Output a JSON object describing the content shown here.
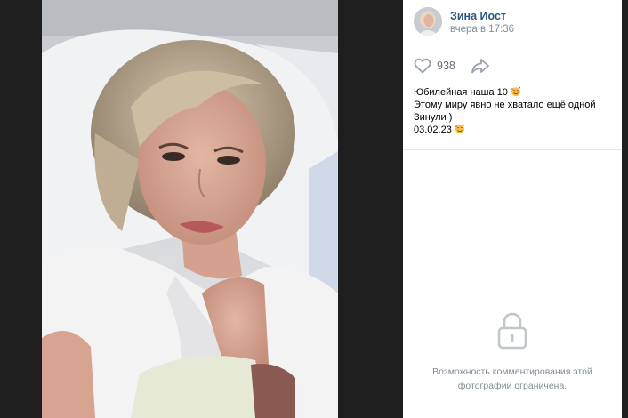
{
  "post": {
    "author_name": "Зина Иост",
    "time": "вчера в 17:36",
    "likes": "938",
    "caption_lines": [
      "Юбилейная наша 10",
      "Этому миру явно не хватало ещё одной",
      "Зинули )",
      "03.02.23"
    ]
  },
  "comments": {
    "restricted_line1": "Возможность комментирования этой",
    "restricted_line2": "фотографии ограничена."
  },
  "icons": {
    "like": "heart-icon",
    "share": "share-arrow-icon",
    "lock": "lock-icon",
    "emoji": "smiling-face-with-hearts-emoji"
  },
  "colors": {
    "author_link": "#2a5885",
    "secondary_text": "#818c99",
    "icon_gray": "#99a2ad",
    "backdrop": "#1e1e1e"
  }
}
